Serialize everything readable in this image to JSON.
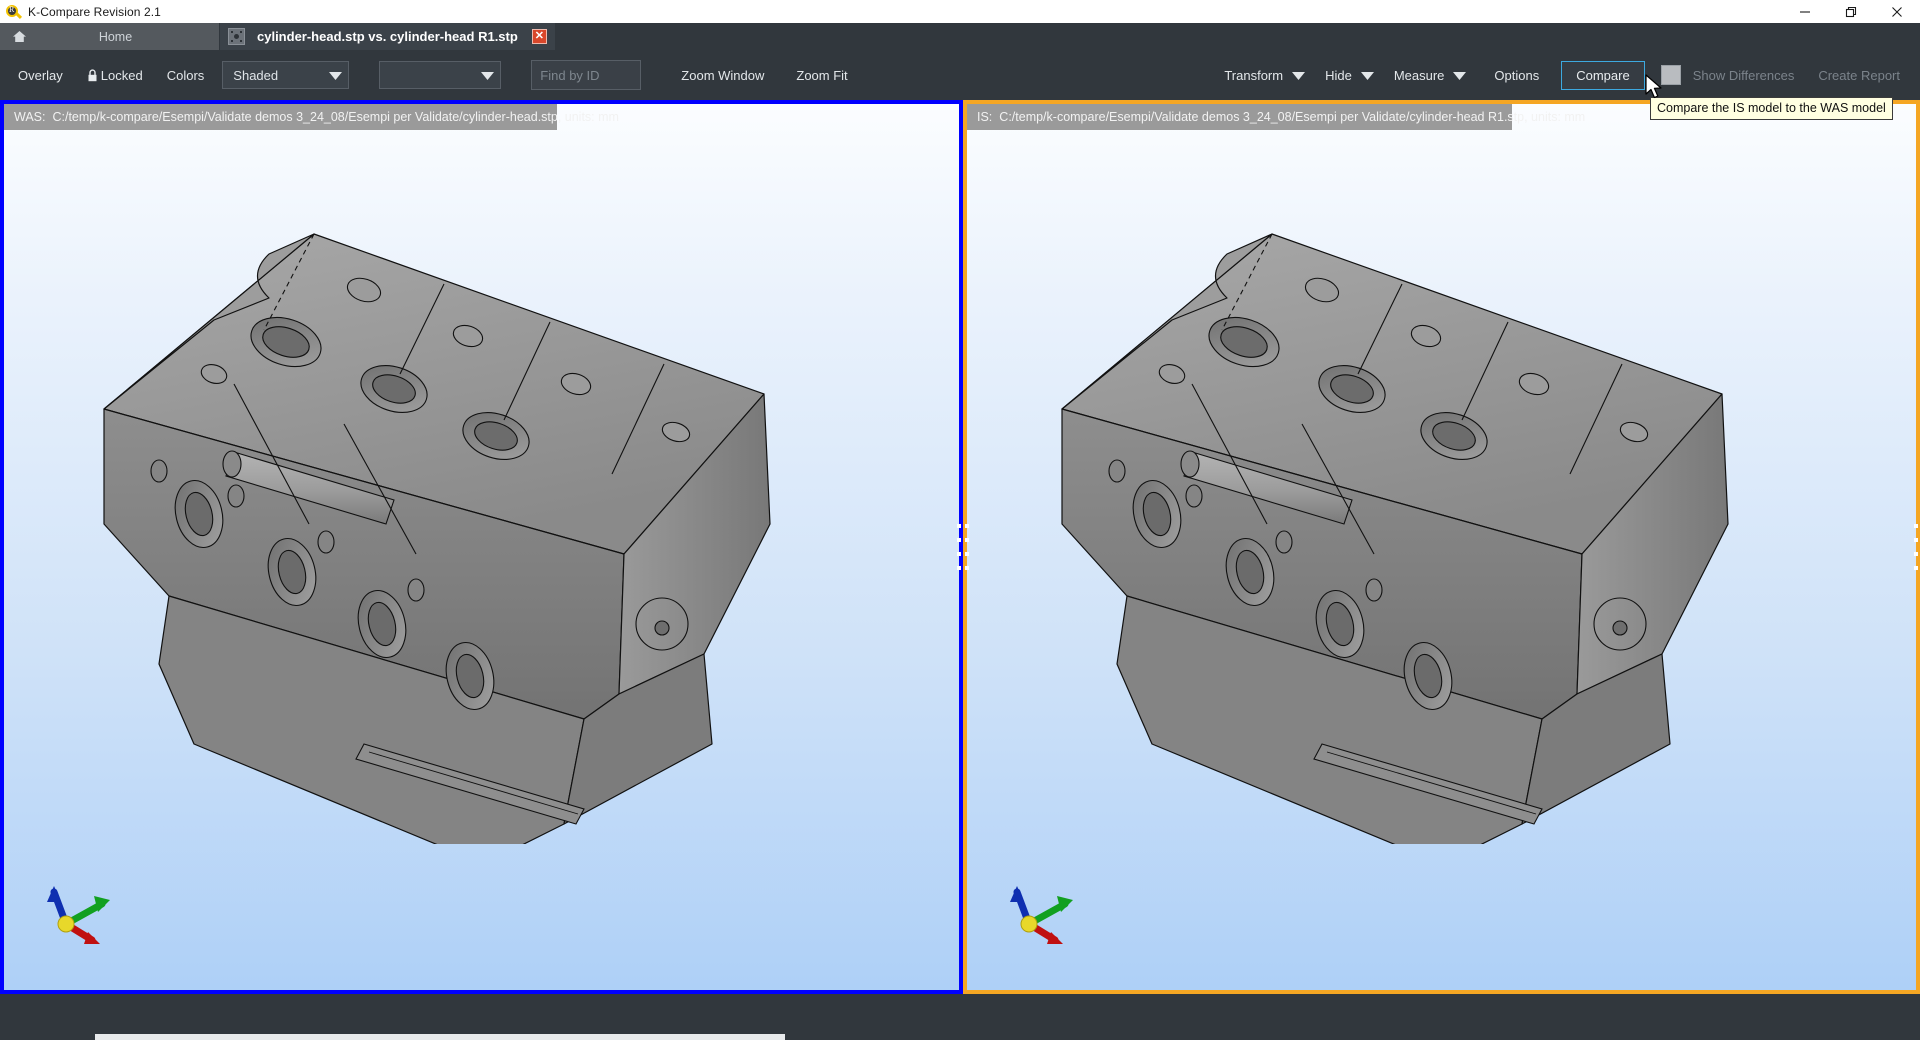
{
  "window": {
    "title": "K-Compare Revision 2.1",
    "app_icon": "magnifier-r-icon",
    "controls": {
      "minimize": "minimize-icon",
      "maximize": "maximize-icon",
      "close": "close-icon"
    }
  },
  "tabs": [
    {
      "id": "home",
      "label": "Home",
      "icon": "home-icon",
      "active": false
    },
    {
      "id": "compare-doc",
      "label": "cylinder-head.stp vs. cylinder-head R1.stp",
      "icon": "document-icon",
      "active": true,
      "close_label": "✕"
    }
  ],
  "toolbar": {
    "overlay_label": "Overlay",
    "locked_label": "Locked",
    "locked_icon": "lock-icon",
    "colors_label": "Colors",
    "display_mode": {
      "value": "Shaded",
      "placeholder": "",
      "caret": "chevron-down-icon"
    },
    "secondary_select": {
      "value": "",
      "placeholder": "",
      "caret": "chevron-down-icon"
    },
    "find_by_id": {
      "value": "",
      "placeholder": "Find by ID"
    },
    "zoom_window_label": "Zoom Window",
    "zoom_fit_label": "Zoom Fit",
    "transform_label": "Transform",
    "hide_label": "Hide",
    "measure_label": "Measure",
    "options_label": "Options",
    "compare_label": "Compare",
    "show_differences_label": "Show Differences",
    "create_report_label": "Create Report"
  },
  "tooltip": {
    "text": "Compare the IS model to the WAS model"
  },
  "panels": {
    "was": {
      "key": "WAS:",
      "path": "C:/temp/k-compare/Esempi/Validate demos 3_24_08/Esempi per Validate/cylinder-head.stp, units: mm",
      "border_color": "#0000ff",
      "model_name": "cylinder-head-3d-model",
      "triad_icon": "axis-triad-icon"
    },
    "is": {
      "key": "IS:",
      "path": "C:/temp/k-compare/Esempi/Validate demos 3_24_08/Esempi per Validate/cylinder-head R1.stp, units: mm",
      "border_color": "#f5a623",
      "model_name": "cylinder-head-3d-model",
      "triad_icon": "axis-triad-icon"
    }
  },
  "colors": {
    "chrome": "#31373d",
    "tab_active": "#3b4249",
    "tab_inactive": "#54595e",
    "accent_blue": "#0000ff",
    "accent_orange": "#f5a623",
    "focus_outline": "#3da9e0",
    "model_gray": "#8f8f8f",
    "tooltip_bg": "#ffffe1"
  }
}
